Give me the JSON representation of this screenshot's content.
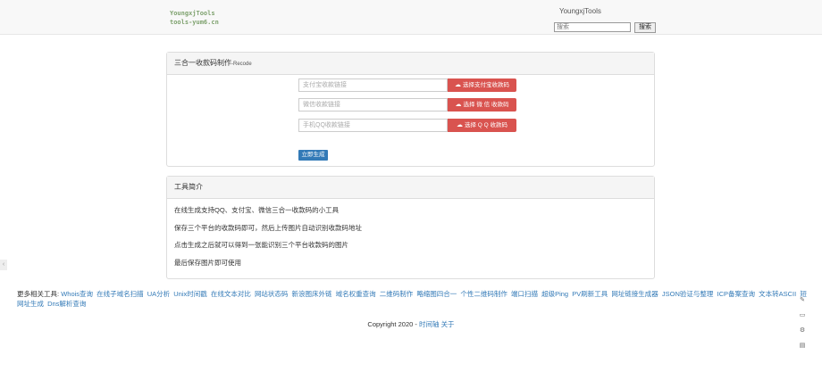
{
  "header": {
    "logo_line1": "YoungxjTools",
    "logo_line2": "tools-yum6.cn",
    "site_title": "YoungxjTools",
    "search_placeholder": "搜索",
    "search_button": "搜索"
  },
  "generator": {
    "title": "三合一收款码制作",
    "title_sub": "-Recode",
    "rows": [
      {
        "placeholder": "支付宝收款链接",
        "button": "选择支付宝收款码"
      },
      {
        "placeholder": "微信收款链接",
        "button": "选择 微 信 收款码"
      },
      {
        "placeholder": "手机QQ收款链接",
        "button": "选择 Q Q 收款码"
      }
    ],
    "generate_button": "立即生成"
  },
  "intro": {
    "title": "工具简介",
    "lines": [
      "在线生成支持QQ、支付宝、微信三合一收款码的小工具",
      "保存三个平台的收款码即可，然后上传图片自动识别收款码地址",
      "点击生成之后就可以得到一张能识别三个平台收款码的图片",
      "最后保存图片即可使用"
    ]
  },
  "more_tools": {
    "label": "更多相关工具:",
    "links": [
      "Whois查询",
      "在线子域名扫描",
      "UA分析",
      "Unix时间戳",
      "在线文本对比",
      "网站状态码",
      "新浪图床外链",
      "域名权重查询",
      "二维码制作",
      "略缩图四合一",
      "个性二维码制作",
      "端口扫描",
      "超级Ping",
      "PV刷新工具",
      "网址链接生成器",
      "JSON验证与整理",
      "ICP备案查询",
      "文本转ASCII",
      "短网址生成",
      "Dns解析查询"
    ]
  },
  "footer": {
    "copyright": "Copyright 2020 -",
    "link1": "时间轴",
    "link2": "关于"
  },
  "icons": {
    "cloud": "cloud-upload-icon",
    "float1": "edit-icon",
    "float2": "monitor-icon",
    "float3": "gear-icon",
    "float4": "print-icon"
  },
  "colors": {
    "danger": "#d9534f",
    "primary": "#337ab7",
    "logo": "#7fa26f"
  }
}
